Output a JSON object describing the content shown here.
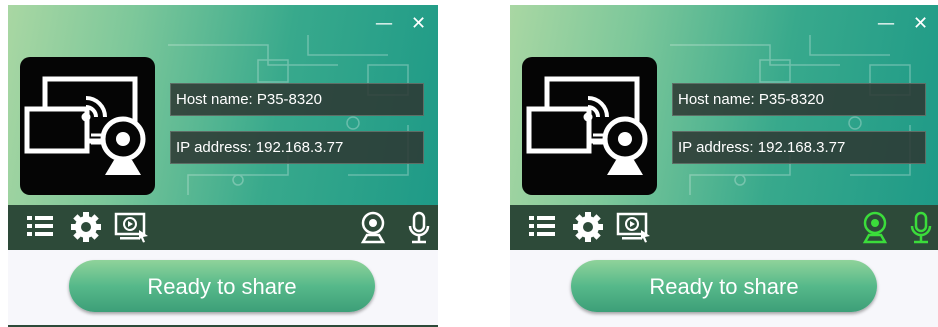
{
  "panels": [
    {
      "id": "left",
      "window_controls": {
        "minimize": "—",
        "close": "✕"
      },
      "host_name": "Host name: P35-8320",
      "ip_address": "IP address: 192.168.3.77",
      "toolbar": {
        "menu_icon": "list-icon",
        "settings_icon": "gear-icon",
        "screen_share_icon": "screen-play-icon",
        "webcam_icon": "webcam-icon",
        "microphone_icon": "microphone-icon",
        "webcam_active": false,
        "microphone_active": false
      },
      "share_button_label": "Ready to share"
    },
    {
      "id": "right",
      "window_controls": {
        "minimize": "—",
        "close": "✕"
      },
      "host_name": "Host name: P35-8320",
      "ip_address": "IP address: 192.168.3.77",
      "toolbar": {
        "menu_icon": "list-icon",
        "settings_icon": "gear-icon",
        "screen_share_icon": "screen-play-icon",
        "webcam_icon": "webcam-icon",
        "microphone_icon": "microphone-icon",
        "webcam_active": true,
        "microphone_active": true
      },
      "share_button_label": "Ready to share"
    }
  ],
  "colors": {
    "toolbar_bg": "#2d4a39",
    "icon_inactive": "#ffffff",
    "icon_active": "#3bdc3b",
    "button_green": "#56b98a",
    "field_bg": "#2d3732"
  }
}
